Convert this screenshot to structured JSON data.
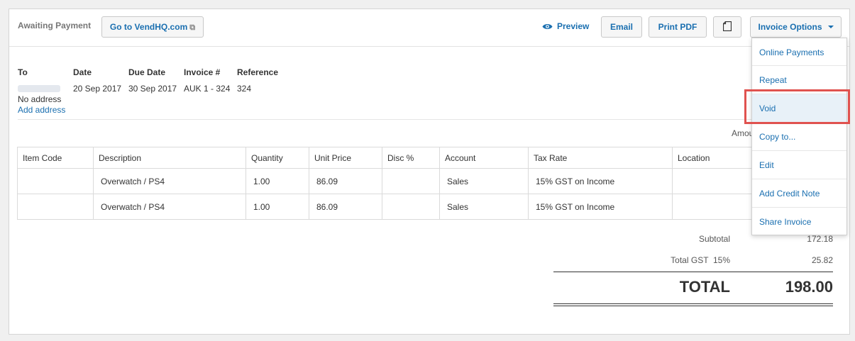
{
  "header": {
    "status": "Awaiting Payment",
    "goto_label": "Go to VendHQ.com",
    "preview_label": "Preview",
    "email_label": "Email",
    "printpdf_label": "Print PDF",
    "options_label": "Invoice Options"
  },
  "invoice": {
    "to_label": "To",
    "date_label": "Date",
    "date": "20 Sep 2017",
    "due_label": "Due Date",
    "due": "30 Sep 2017",
    "number_label": "Invoice #",
    "number": "AUK 1 - 324",
    "reference_label": "Reference",
    "reference": "324",
    "no_address": "No address",
    "add_address": "Add address",
    "amounts_label": "Amou"
  },
  "table": {
    "columns": [
      "Item Code",
      "Description",
      "Quantity",
      "Unit Price",
      "Disc %",
      "Account",
      "Tax Rate",
      "Location"
    ],
    "rows": [
      {
        "code": "",
        "description": "Overwatch / PS4",
        "quantity": "1.00",
        "unit_price": "86.09",
        "disc": "",
        "account": "Sales",
        "tax_rate": "15% GST on Income",
        "location": ""
      },
      {
        "code": "",
        "description": "Overwatch / PS4",
        "quantity": "1.00",
        "unit_price": "86.09",
        "disc": "",
        "account": "Sales",
        "tax_rate": "15% GST on Income",
        "location": ""
      }
    ]
  },
  "totals": {
    "subtotal_label": "Subtotal",
    "subtotal": "172.18",
    "gst_label": "Total GST  15%",
    "gst": "25.82",
    "total_label": "TOTAL",
    "total": "198.00"
  },
  "menu": {
    "items": [
      "Online Payments",
      "Repeat",
      "Void",
      "Copy to...",
      "Edit",
      "Add Credit Note",
      "Share Invoice"
    ]
  },
  "colors": {
    "link": "#1a6fb0",
    "highlight": "#e0524f"
  }
}
